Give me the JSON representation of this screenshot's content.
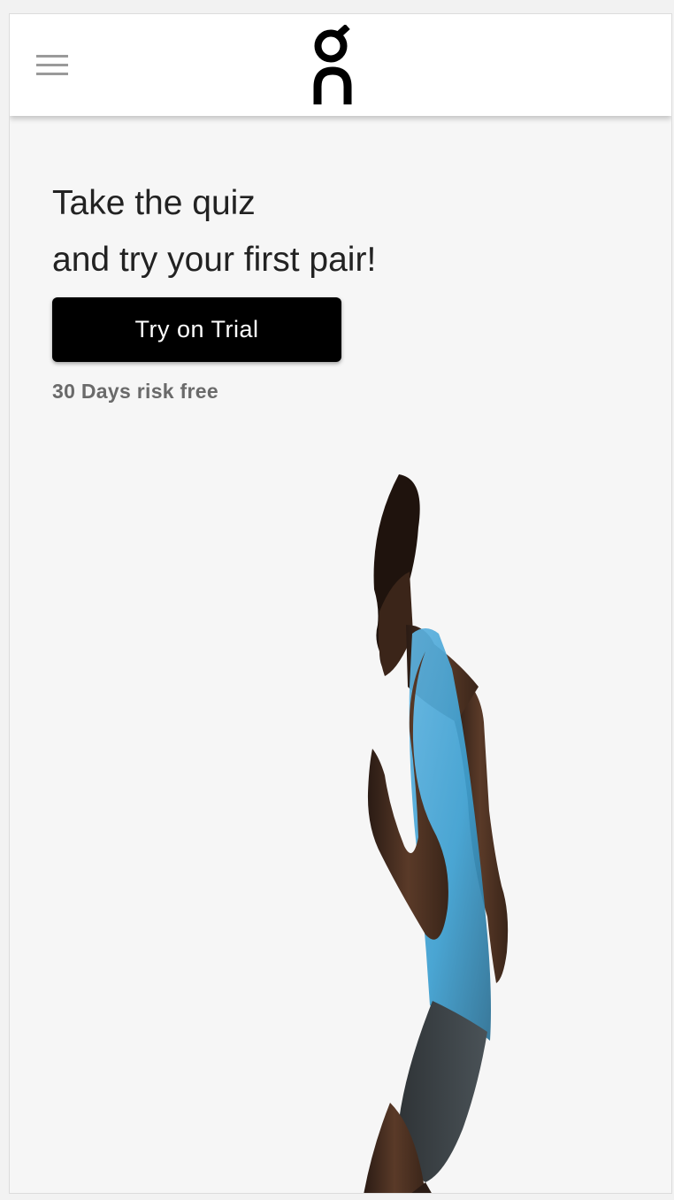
{
  "header": {
    "logo_alt": "On"
  },
  "hero": {
    "headline_line1": "Take the quiz",
    "headline_line2": "and try your first pair!",
    "cta_label": "Try on Trial",
    "subtext": "30 Days risk free"
  },
  "colors": {
    "page_background": "#f6f6f6",
    "header_background": "#ffffff",
    "cta_background": "#000000",
    "cta_text": "#ffffff",
    "headline_text": "#222222",
    "subtext": "#6a6a6a",
    "menu_icon": "#9a9a9a",
    "singlet_accent": "#3d9fd0"
  },
  "icons": {
    "menu": "hamburger-menu-icon",
    "logo": "on-logo"
  }
}
